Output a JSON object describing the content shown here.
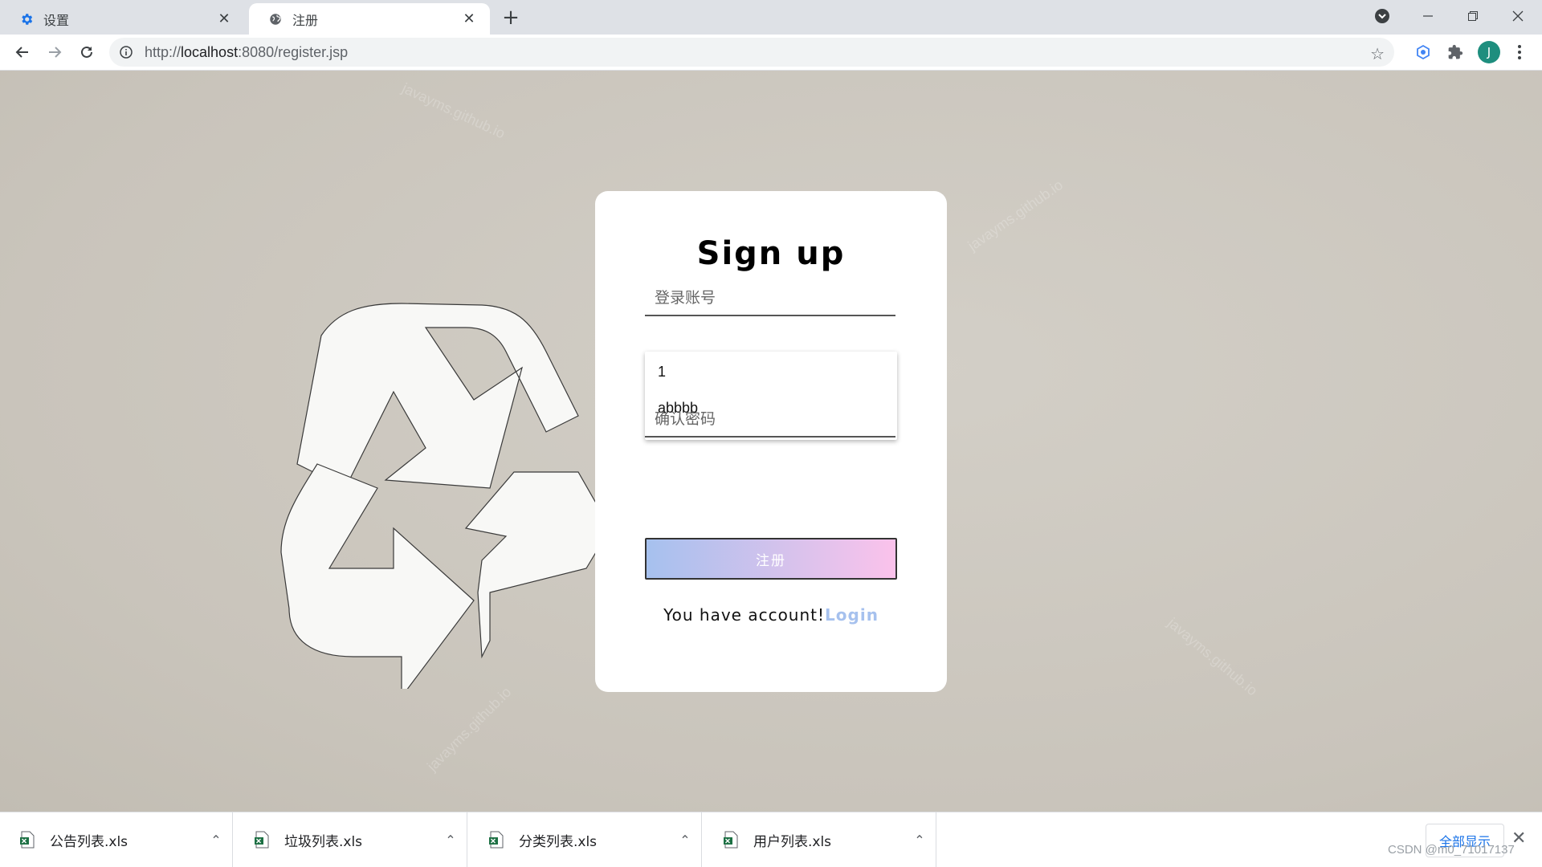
{
  "browser": {
    "tabs": [
      {
        "title": "设置",
        "icon": "gear-icon"
      },
      {
        "title": "注册",
        "icon": "globe-icon"
      }
    ],
    "new_tab": "+",
    "address": {
      "scheme_host": "http://",
      "host": "localhost",
      "rest": ":8080/register.jsp"
    },
    "profile_initial": "J"
  },
  "page": {
    "watermark": "javayms.github.io",
    "form": {
      "title": "Sign up",
      "account_placeholder": "登录账号",
      "confirm_password_placeholder": "确认密码",
      "autocomplete": [
        "1",
        "abbbb"
      ],
      "submit_label": "注册",
      "footer_text": "You have account!",
      "login_link": "Login"
    }
  },
  "downloads": {
    "items": [
      "公告列表.xls",
      "垃圾列表.xls",
      "分类列表.xls",
      "用户列表.xls"
    ],
    "show_all": "全部显示"
  },
  "credit": "CSDN @m0_71017137",
  "colors": {
    "gradient_start": "#a6c1ee",
    "gradient_end": "#fbc2eb",
    "avatar": "#1e8e7e"
  }
}
